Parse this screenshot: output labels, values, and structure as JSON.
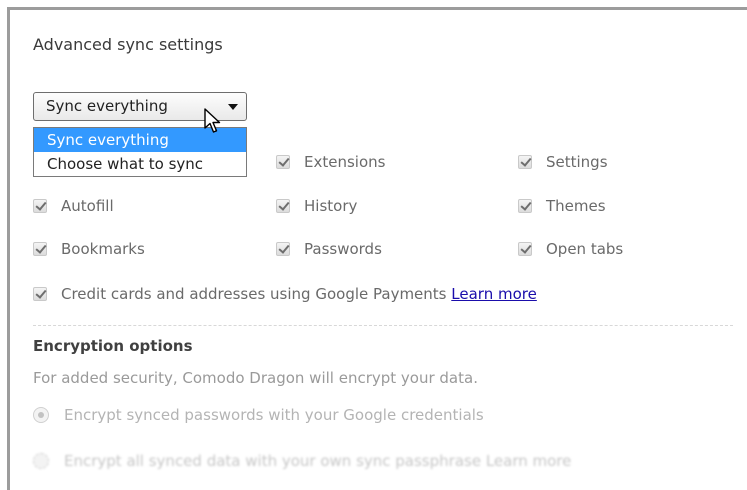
{
  "dialog": {
    "title": "Advanced sync settings",
    "dropdown": {
      "selected": "Sync everything",
      "options": [
        "Sync everything",
        "Choose what to sync"
      ],
      "highlighted_option": "Sync everything"
    },
    "data_types": [
      {
        "label": "Extensions",
        "checked": true
      },
      {
        "label": "Settings",
        "checked": true
      },
      {
        "label": "Autofill",
        "checked": true
      },
      {
        "label": "History",
        "checked": true
      },
      {
        "label": "Themes",
        "checked": true
      },
      {
        "label": "Bookmarks",
        "checked": true
      },
      {
        "label": "Passwords",
        "checked": true
      },
      {
        "label": "Open tabs",
        "checked": true
      }
    ],
    "payments": {
      "label": "Credit cards and addresses using Google Payments",
      "link": "Learn more",
      "checked": true
    },
    "encryption": {
      "title": "Encryption options",
      "description": "For added security, Comodo Dragon will encrypt your data.",
      "options": [
        {
          "label": "Encrypt synced passwords with your Google credentials",
          "selected": true
        },
        {
          "label": "Encrypt all synced data with your own sync passphrase Learn more",
          "selected": false
        }
      ]
    }
  },
  "colors": {
    "highlight": "#3399ff",
    "link": "#1a0dab"
  }
}
